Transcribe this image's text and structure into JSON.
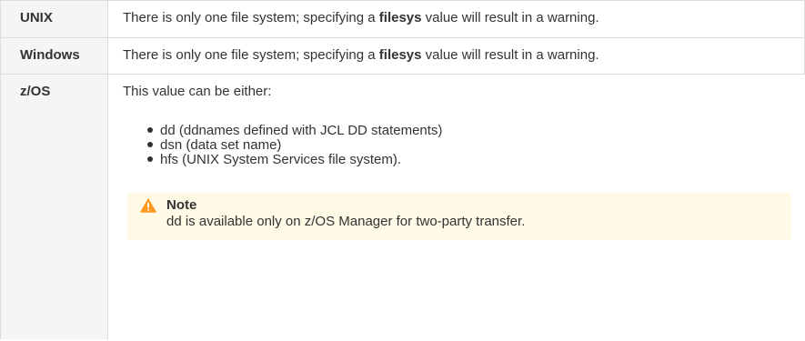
{
  "rows": [
    {
      "platform": "UNIX",
      "text_before": "There is only one file system; specifying a ",
      "keyword": "filesys",
      "text_after": " value will result in a warning."
    },
    {
      "platform": "Windows",
      "text_before": "There is only one file system; specifying a ",
      "keyword": "filesys",
      "text_after": " value will result in a warning."
    },
    {
      "platform": "z/OS",
      "intro": "This value can be either:",
      "options": [
        "dd (ddnames defined with JCL DD statements)",
        "dsn (data set name)",
        "hfs (UNIX System Services file system)."
      ],
      "note": {
        "icon": "warning-icon",
        "title": "Note",
        "body": "dd is available only on z/OS Manager for two-party transfer."
      }
    }
  ],
  "colors": {
    "header_bg": "#f4f5f7",
    "border": "#dddddd",
    "note_bg": "#fffae6",
    "warning_icon": "#ff991f",
    "text": "#333333"
  }
}
